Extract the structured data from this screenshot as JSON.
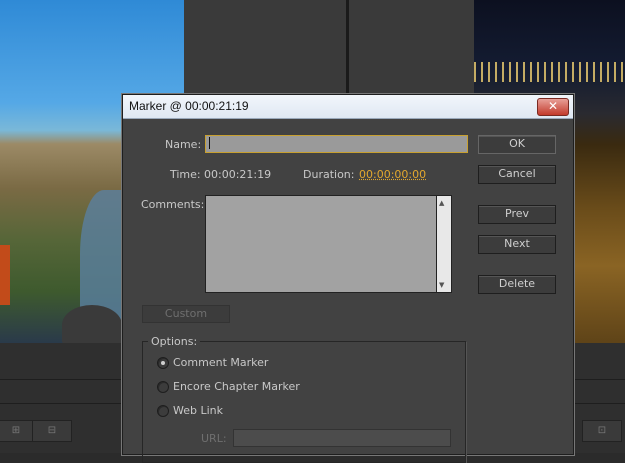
{
  "dialog": {
    "title": "Marker @ 00:00:21:19",
    "close_glyph": "✕",
    "name_label": "Name:",
    "name_value": "",
    "time_label": "Time:",
    "time_value": "00:00:21:19",
    "duration_label": "Duration:",
    "duration_value": "00:00:00:00",
    "comments_label": "Comments:",
    "comments_value": "",
    "buttons": {
      "ok": "OK",
      "cancel": "Cancel",
      "prev": "Prev",
      "next": "Next",
      "delete": "Delete",
      "custom": "Custom"
    },
    "options": {
      "legend": "Options:",
      "items": [
        {
          "label": "Comment Marker",
          "selected": true
        },
        {
          "label": "Encore Chapter Marker",
          "selected": false
        },
        {
          "label": "Web Link",
          "selected": false
        }
      ],
      "url_label": "URL:"
    }
  },
  "colors": {
    "dialog_bg": "#424242",
    "duration_accent": "#e2a72e",
    "input_focus_border": "#c8a030",
    "close_button": "#c23a2c"
  }
}
